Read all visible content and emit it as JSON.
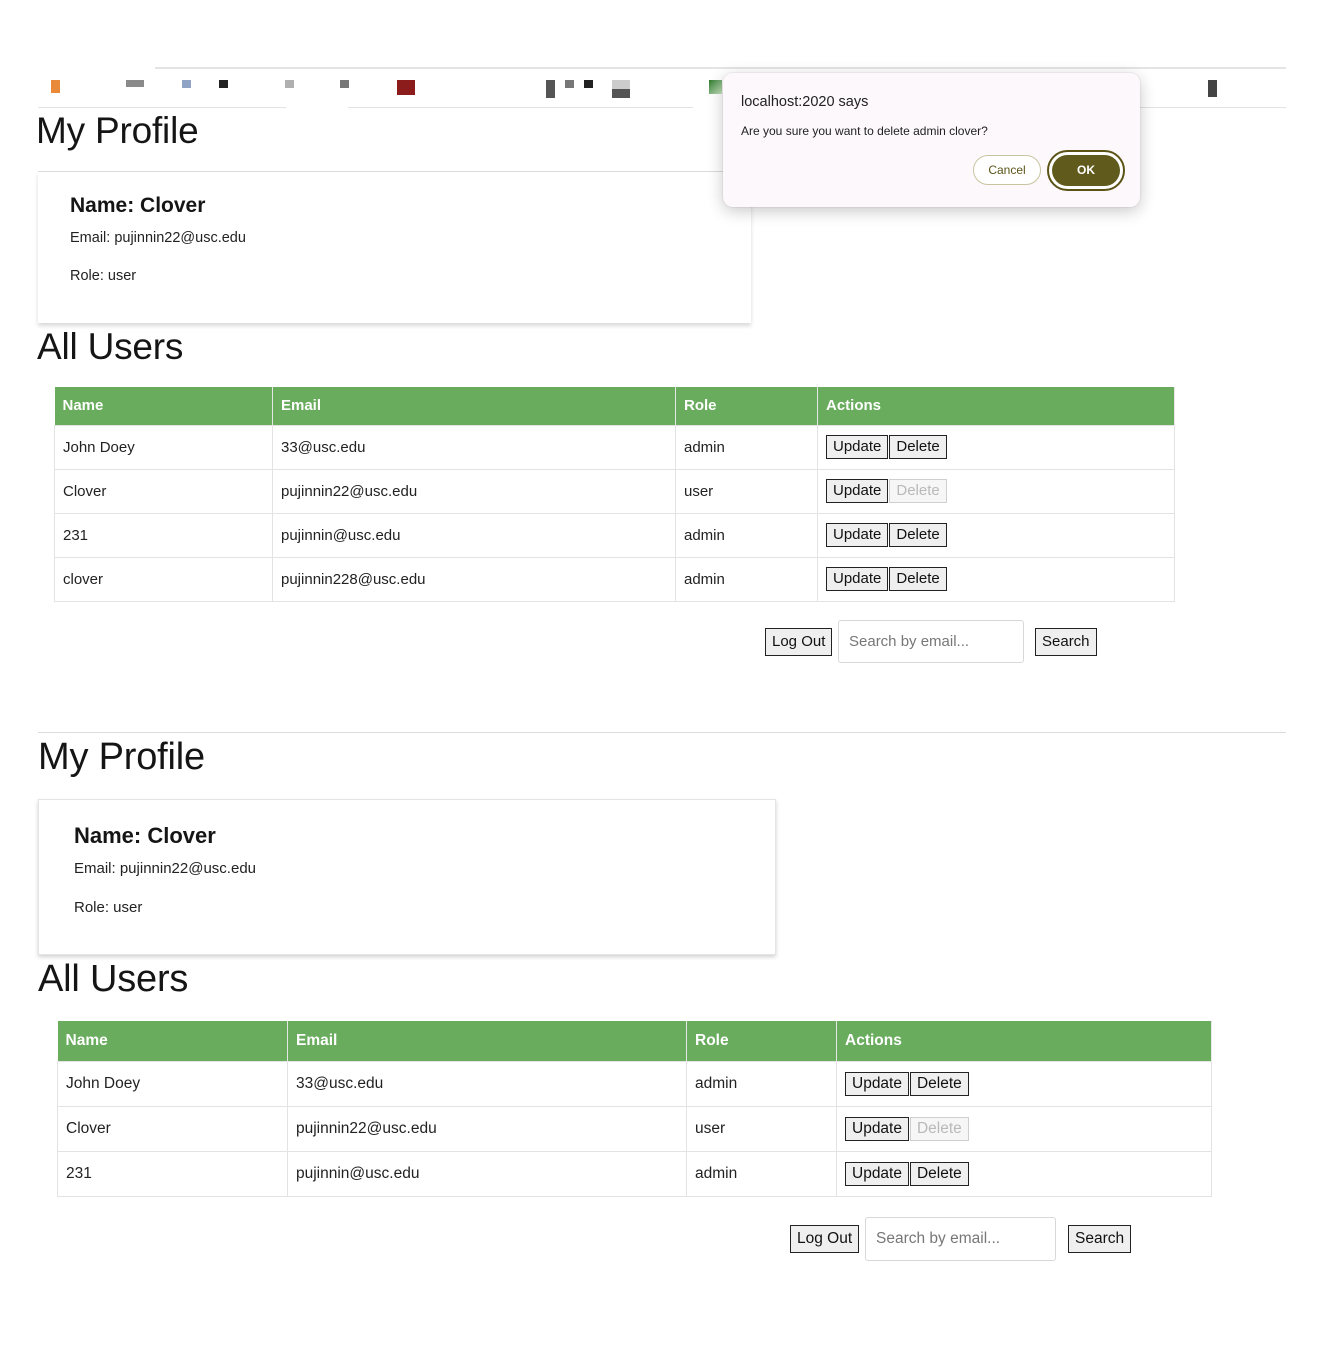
{
  "dialog": {
    "title": "localhost:2020 says",
    "message": "Are you sure you want to delete admin clover?",
    "cancel_label": "Cancel",
    "ok_label": "OK"
  },
  "top_section": {
    "profile_heading": "My Profile",
    "profile": {
      "name": "Name: Clover",
      "email": "Email: pujinnin22@usc.edu",
      "role": "Role: user"
    },
    "users_heading": "All Users",
    "columns": [
      "Name",
      "Email",
      "Role",
      "Actions"
    ],
    "rows": [
      {
        "name": "John Doey",
        "email": "33@usc.edu",
        "role": "admin",
        "update": "Update",
        "delete": "Delete",
        "delete_disabled": false
      },
      {
        "name": "Clover",
        "email": "pujinnin22@usc.edu",
        "role": "user",
        "update": "Update",
        "delete": "Delete",
        "delete_disabled": true
      },
      {
        "name": "231",
        "email": "pujinnin@usc.edu",
        "role": "admin",
        "update": "Update",
        "delete": "Delete",
        "delete_disabled": false
      },
      {
        "name": "clover",
        "email": "pujinnin228@usc.edu",
        "role": "admin",
        "update": "Update",
        "delete": "Delete",
        "delete_disabled": false
      }
    ],
    "logout_label": "Log Out",
    "search_placeholder": "Search by email...",
    "search_label": "Search"
  },
  "bottom_section": {
    "profile_heading": "My Profile",
    "profile": {
      "name": "Name: Clover",
      "email": "Email: pujinnin22@usc.edu",
      "role": "Role: user"
    },
    "users_heading": "All Users",
    "columns": [
      "Name",
      "Email",
      "Role",
      "Actions"
    ],
    "rows": [
      {
        "name": "John Doey",
        "email": "33@usc.edu",
        "role": "admin",
        "update": "Update",
        "delete": "Delete",
        "delete_disabled": false
      },
      {
        "name": "Clover",
        "email": "pujinnin22@usc.edu",
        "role": "user",
        "update": "Update",
        "delete": "Delete",
        "delete_disabled": true
      },
      {
        "name": "231",
        "email": "pujinnin@usc.edu",
        "role": "admin",
        "update": "Update",
        "delete": "Delete",
        "delete_disabled": false
      }
    ],
    "logout_label": "Log Out",
    "search_placeholder": "Search by email...",
    "search_label": "Search"
  },
  "colors": {
    "table_header": "#69ac5d",
    "dialog_ok": "#605a1c",
    "dialog_background": "#fdf8fb"
  }
}
